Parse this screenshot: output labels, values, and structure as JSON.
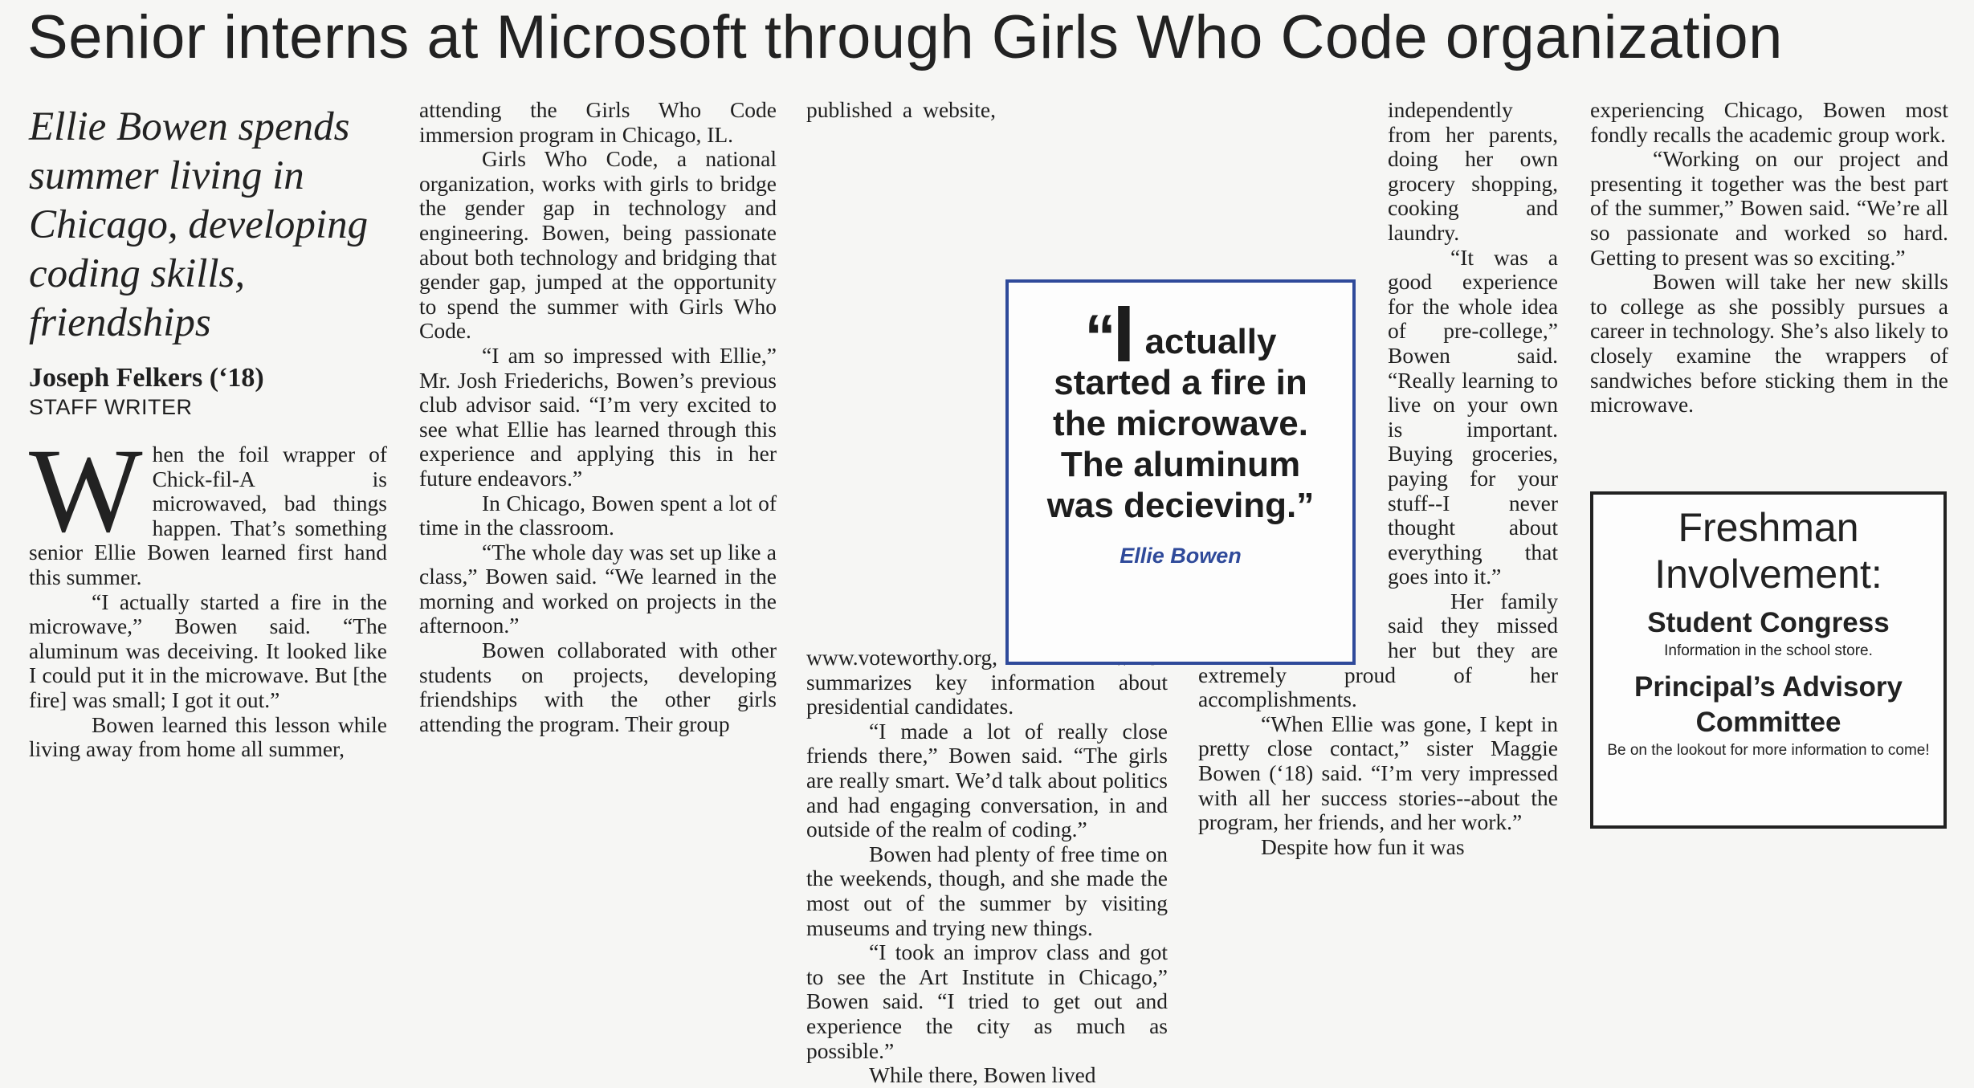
{
  "headline": "Senior interns at Microsoft through Girls Who Code organization",
  "deck": "Ellie Bowen spends summer living in Chicago, developing coding skills, friendships",
  "byline": {
    "name": "Joseph Felkers (‘18)",
    "role": "STAFF WRITER"
  },
  "dropcap": "W",
  "col1": {
    "p1_rest": "hen the foil wrapper of Chick-fil-A is microwaved, bad things happen. That’s something senior Ellie Bowen learned first hand this summer.",
    "p2": "“I actually started a fire in the microwave,” Bowen said. “The aluminum was deceiving. It looked like I could put it in the microwave. But [the fire] was small; I got it out.”",
    "p3": "Bowen learned this lesson while living away from home all summer,"
  },
  "col2": {
    "p1": "attending the Girls Who Code immersion program in Chicago, IL.",
    "p2": "Girls Who Code, a national organization, works with girls to bridge the gender gap in technology and engineering. Bowen, being passionate about both technology and bridging that gender gap, jumped at the opportunity to spend the summer with Girls Who Code.",
    "p3": "“I am so impressed with Ellie,” Mr. Josh Friederichs, Bowen’s previous club advisor said. “I’m very excited to see what Ellie has learned through this experience and applying this in her future endeavors.”",
    "p4": "In Chicago, Bowen spent a lot of time in the classroom.",
    "p5": "“The whole day was set up like a class,” Bowen said. “We learned in the morning and worked on projects in the afternoon.”",
    "p6": "Bowen collaborated with other students on projects, developing friendships with the other girls attending the program. Their group"
  },
  "col3": {
    "p1": "published a website, www.voteworthy.org, which summarizes key information about presidential candidates.",
    "p2": "“I made a lot of really close friends there,” Bowen said. “The girls are really smart. We’d talk about politics and had engaging conversation, in and outside of the realm of coding.”",
    "p3": "Bowen had plenty of free time on the weekends, though, and she made the most out of the summer by visiting museums and trying new things.",
    "p4": "“I took an improv class and got to see the Art Institute in Chicago,” Bowen said. “I tried to get out and experience the city as much as possible.”",
    "p5": "While there, Bowen lived"
  },
  "col4": {
    "p1": "independently from her parents, doing her own grocery shopping, cooking and laundry.",
    "p2": "“It was a good experience for the whole idea of pre-college,” Bowen said. “Really learning to live on your own is important. Buying groceries, paying for your stuff--I never thought about everything that goes into it.”",
    "p3": "Her family said they missed her but they are extremely proud of her accomplishments.",
    "p4": "“When Ellie was gone, I kept in pretty close contact,” sister Maggie Bowen (‘18) said. “I’m very impressed with all her success stories--about the program, her friends, and her work.”",
    "p5": "Despite how fun it was"
  },
  "col5": {
    "p1": "experiencing Chicago, Bowen most fondly recalls the academic group work.",
    "p2": "“Working on our project and presenting it together was the best part of the summer,” Bowen said. “We’re all so passionate and worked so hard. Getting to present was so exciting.”",
    "p3": "Bowen will take her new skills to college as she possibly pursues a career in technology. She’s also likely to closely examine the wrappers of sandwiches before sticking them in the microwave."
  },
  "pullquote": {
    "open": "“",
    "big": "I",
    "text": "actually started a fire in the microwave. The aluminum was decieving.”",
    "attribution": "Ellie Bowen"
  },
  "sidebar": {
    "title": "Freshman Involvement:",
    "item1": "Student Congress",
    "note1": "Information in the school store.",
    "item2": "Principal’s Advisory Committee",
    "note2": "Be on the lookout for more information to come!"
  },
  "colors": {
    "pullquote_border": "#2f4a9a",
    "attribution": "#2f4a9a",
    "text": "#1f1f1f"
  }
}
